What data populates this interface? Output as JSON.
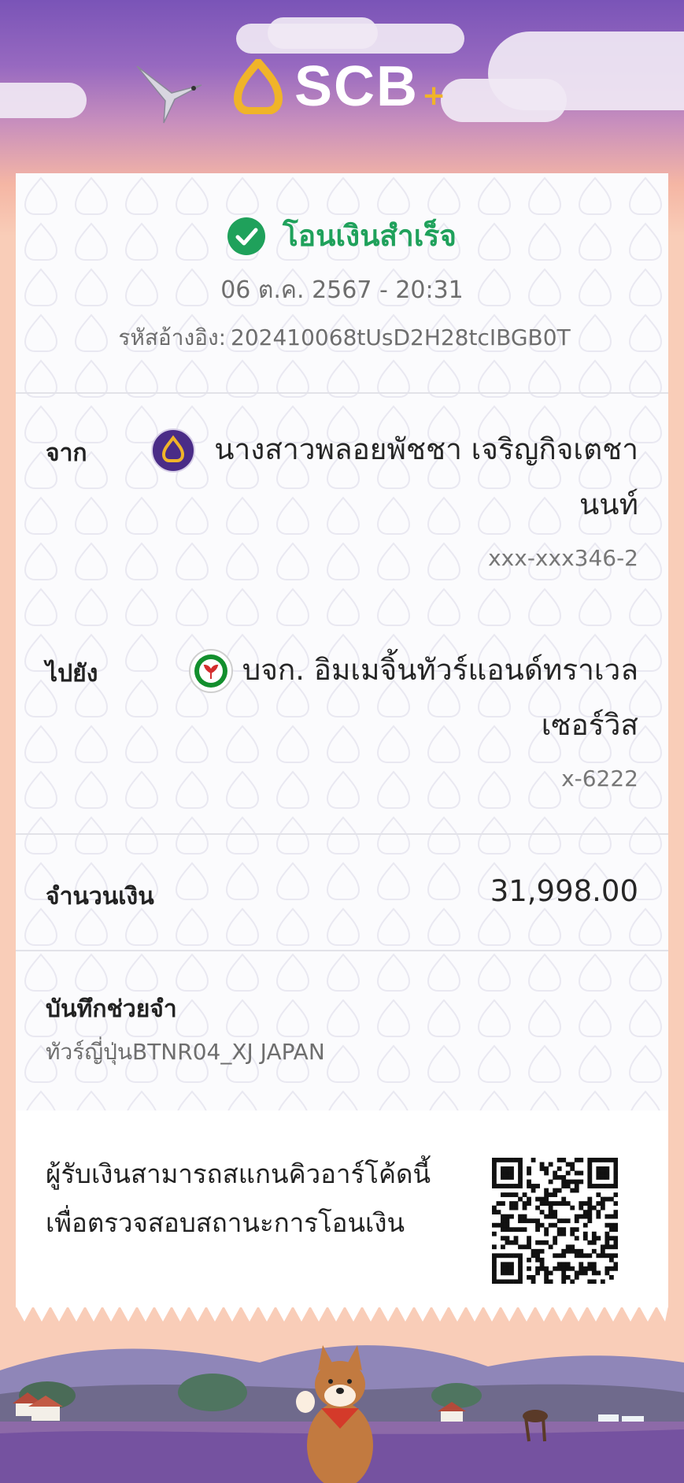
{
  "brand": {
    "name": "SCB",
    "plus": "+"
  },
  "colors": {
    "success": "#1fa15b",
    "brand_purple": "#4a2c87",
    "kbank_green": "#138f2d"
  },
  "receipt": {
    "status": "โอนเงินสำเร็จ",
    "datetime": "06 ต.ค. 2567 - 20:31",
    "ref_label": "รหัสอ้างอิง:",
    "ref_value": "202410068tUsD2H28tcIBGB0T"
  },
  "from": {
    "label": "จาก",
    "name_line1": "นางสาวพลอยพัชชา เจริญกิจเตชา",
    "name_line2": "นนท์",
    "account": "xxx-xxx346-2",
    "bank_icon": "scb-logo-icon"
  },
  "to": {
    "label": "ไปยัง",
    "name_line1": "บจก. อิมเมจิ้นทัวร์แอนด์ทราเวล",
    "name_line2": "เซอร์วิส",
    "account": "x-6222",
    "bank_icon": "kbank-logo-icon"
  },
  "amount": {
    "label": "จำนวนเงิน",
    "value": "31,998.00"
  },
  "memo": {
    "label": "บันทึกช่วยจำ",
    "value": "ทัวร์ญี่ปุ่นBTNR04_XJ JAPAN"
  },
  "qr_info": {
    "line1": "ผู้รับเงินสามารถสแกนคิวอาร์โค้ดนี้",
    "line2": "เพื่อตรวจสอบสถานะการโอนเงิน"
  }
}
